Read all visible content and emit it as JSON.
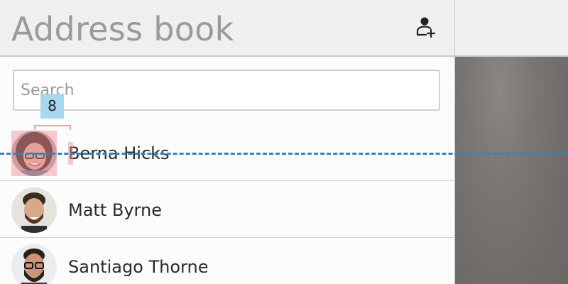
{
  "header": {
    "title": "Address book",
    "add_contact_icon": "person-add-icon"
  },
  "search": {
    "placeholder": "Search",
    "value": ""
  },
  "contacts": [
    {
      "name": "Berna Hicks"
    },
    {
      "name": "Matt Byrne"
    },
    {
      "name": "Santiago Thorne"
    }
  ],
  "overlay": {
    "spacing_label": "8"
  },
  "colors": {
    "header_bg": "#efefef",
    "title": "#9a9a9a",
    "guide_line": "#2e86c1",
    "highlight": "#f08c96",
    "label_bg": "#a8d8ef"
  }
}
